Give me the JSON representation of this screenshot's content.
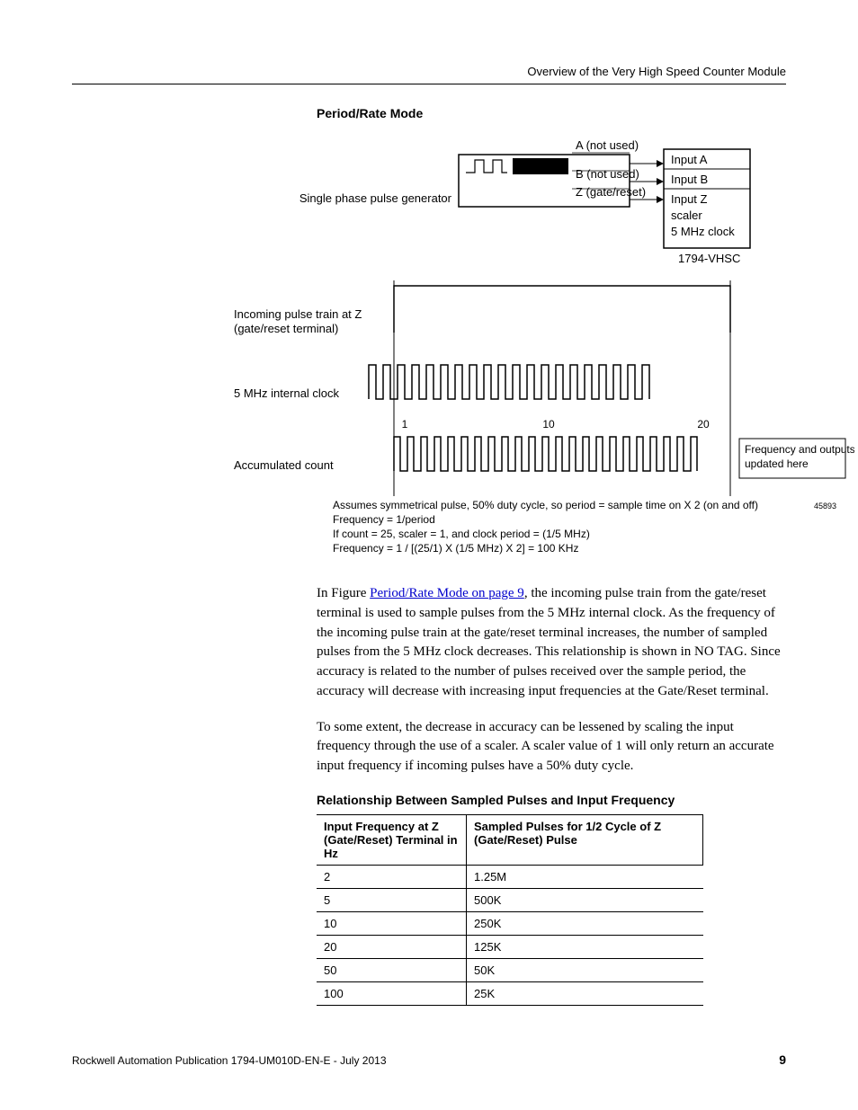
{
  "header": "Overview of the Very High Speed Counter Module",
  "figure_title": "Period/Rate Mode",
  "diagram": {
    "generator_label": "Single phase pulse generator",
    "sig_a": "A (not used)",
    "sig_b": "B (not used)",
    "sig_z": "Z (gate/reset)",
    "input_a": "Input A",
    "input_b": "Input B",
    "input_z": "Input Z",
    "scaler": "scaler",
    "clock_label": "5 MHz clock",
    "device": "1794-VHSC",
    "row1": "Incoming pulse train at Z (gate/reset terminal)",
    "row2": "5 MHz internal clock",
    "row3": "Accumulated count",
    "tick1": "1",
    "tick10": "10",
    "tick20": "20",
    "outbox": "Frequency and outputs updated here",
    "calc1": "Assumes symmetrical pulse, 50% duty cycle, so period = sample time on X 2 (on and off)",
    "calc2": "Frequency = 1/period",
    "calc3": "If count = 25, scaler = 1, and clock period = (1/5 MHz)",
    "calc4": "Frequency = 1 / [(25/1) X (1/5 MHz) X 2] = 100 KHz",
    "artnum": "45893"
  },
  "para1a": "In Figure ",
  "para1link": "Period/Rate Mode on page 9",
  "para1b": ", the incoming pulse train from the gate/reset terminal is used to sample pulses from the 5 MHz internal clock. As the frequency of the incoming pulse train at the gate/reset terminal increases, the number of sampled pulses from the 5 MHz clock decreases. This relationship is shown in NO TAG. Since accuracy is related to the number of pulses received over the sample period, the accuracy will decrease with increasing input frequencies at the Gate/Reset terminal.",
  "para2": "To some extent, the decrease in accuracy can be lessened by scaling the input frequency through the use of a scaler. A scaler value of 1 will only return an accurate input frequency if incoming pulses have a 50% duty cycle.",
  "table_title": "Relationship Between Sampled Pulses and Input Frequency",
  "table": {
    "h1": "Input Frequency at Z (Gate/Reset) Terminal in Hz",
    "h2": "Sampled Pulses for 1/2 Cycle of Z (Gate/Reset) Pulse",
    "rows": [
      {
        "f": "2",
        "s": "1.25M"
      },
      {
        "f": "5",
        "s": "500K"
      },
      {
        "f": "10",
        "s": "250K"
      },
      {
        "f": "20",
        "s": "125K"
      },
      {
        "f": "50",
        "s": "50K"
      },
      {
        "f": "100",
        "s": "25K"
      }
    ]
  },
  "footer": "Rockwell Automation Publication 1794-UM010D-EN-E - July 2013",
  "page_num": "9"
}
